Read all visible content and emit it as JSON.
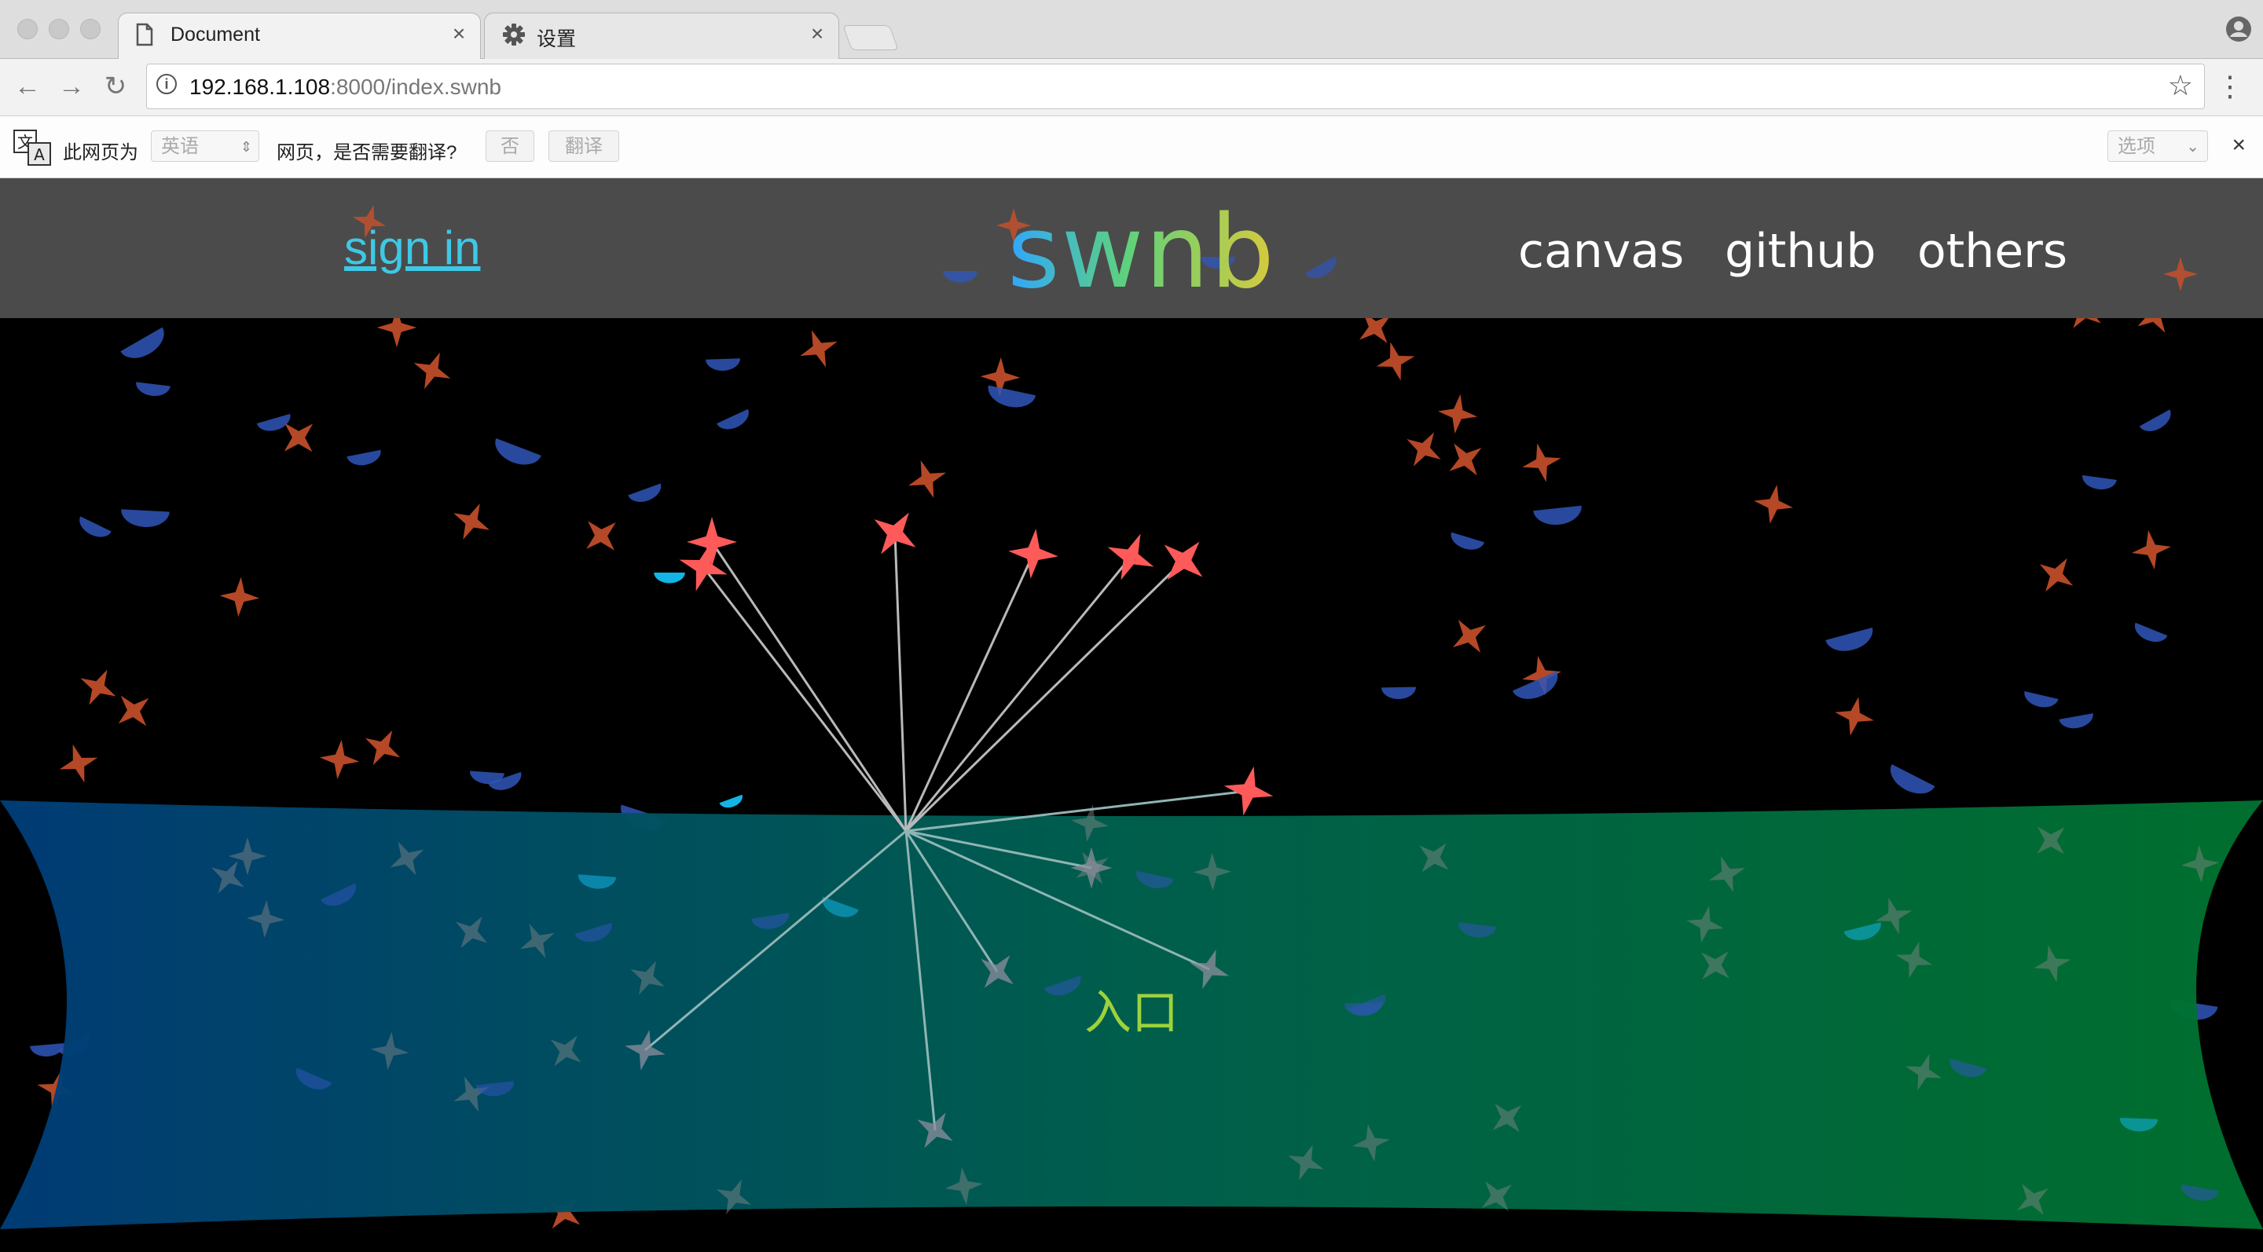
{
  "browser": {
    "tabs": [
      {
        "title": "Document",
        "icon": "document-icon",
        "active": true
      },
      {
        "title": "设置",
        "icon": "gear-icon",
        "active": false
      }
    ],
    "url": {
      "host": "192.168.1.108",
      "rest": ":8000/index.swnb"
    }
  },
  "translate_bar": {
    "prefix": "此网页为",
    "language": "英语",
    "question": "网页，是否需要翻译?",
    "no_button": "否",
    "translate_button": "翻译",
    "options": "选项"
  },
  "site": {
    "signin": "sign in",
    "logo": "swnb",
    "nav": [
      "canvas",
      "github",
      "others"
    ],
    "entry": "入口"
  },
  "colors": {
    "header_bg": "#4b4b4b",
    "signin": "#3ec8e6",
    "banner_gradient": [
      "#003d78",
      "#00614e",
      "#00722f"
    ],
    "star_orange": "#c9502a",
    "star_red": "#ff5a5a",
    "moon_blue": "#2f56b8",
    "moon_cyan": "#12b5e6",
    "entry": "#9cd23c"
  }
}
